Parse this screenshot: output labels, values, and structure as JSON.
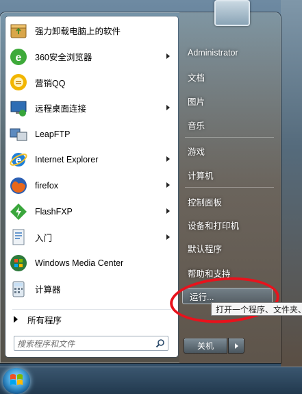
{
  "programs": [
    {
      "label": "强力卸载电脑上的软件",
      "icon": "uninstall-box-icon",
      "arrow": false
    },
    {
      "label": "360安全浏览器",
      "icon": "360-browser-icon",
      "arrow": true
    },
    {
      "label": "营销QQ",
      "icon": "qq-icon",
      "arrow": false
    },
    {
      "label": "远程桌面连接",
      "icon": "remote-desktop-icon",
      "arrow": true
    },
    {
      "label": "LeapFTP",
      "icon": "leapftp-icon",
      "arrow": false
    },
    {
      "label": "Internet Explorer",
      "icon": "internet-explorer-icon",
      "arrow": true
    },
    {
      "label": "firefox",
      "icon": "firefox-icon",
      "arrow": true
    },
    {
      "label": "FlashFXP",
      "icon": "flashfxp-icon",
      "arrow": true
    },
    {
      "label": "入门",
      "icon": "getting-started-icon",
      "arrow": true
    },
    {
      "label": "Windows Media Center",
      "icon": "windows-media-center-icon",
      "arrow": false
    },
    {
      "label": "计算器",
      "icon": "calculator-icon",
      "arrow": false
    }
  ],
  "all_programs_label": "所有程序",
  "search": {
    "placeholder": "搜索程序和文件"
  },
  "right": {
    "user": "Administrator",
    "documents": "文档",
    "pictures": "图片",
    "music": "音乐",
    "games": "游戏",
    "computer": "计算机",
    "control_panel": "控制面板",
    "devices_printers": "设备和打印机",
    "default_programs": "默认程序",
    "help_support": "帮助和支持",
    "run": "运行..."
  },
  "shutdown_label": "关机",
  "tooltip": "打开一个程序、文件夹、",
  "colors": {
    "highlight_oval": "#e8121c"
  }
}
